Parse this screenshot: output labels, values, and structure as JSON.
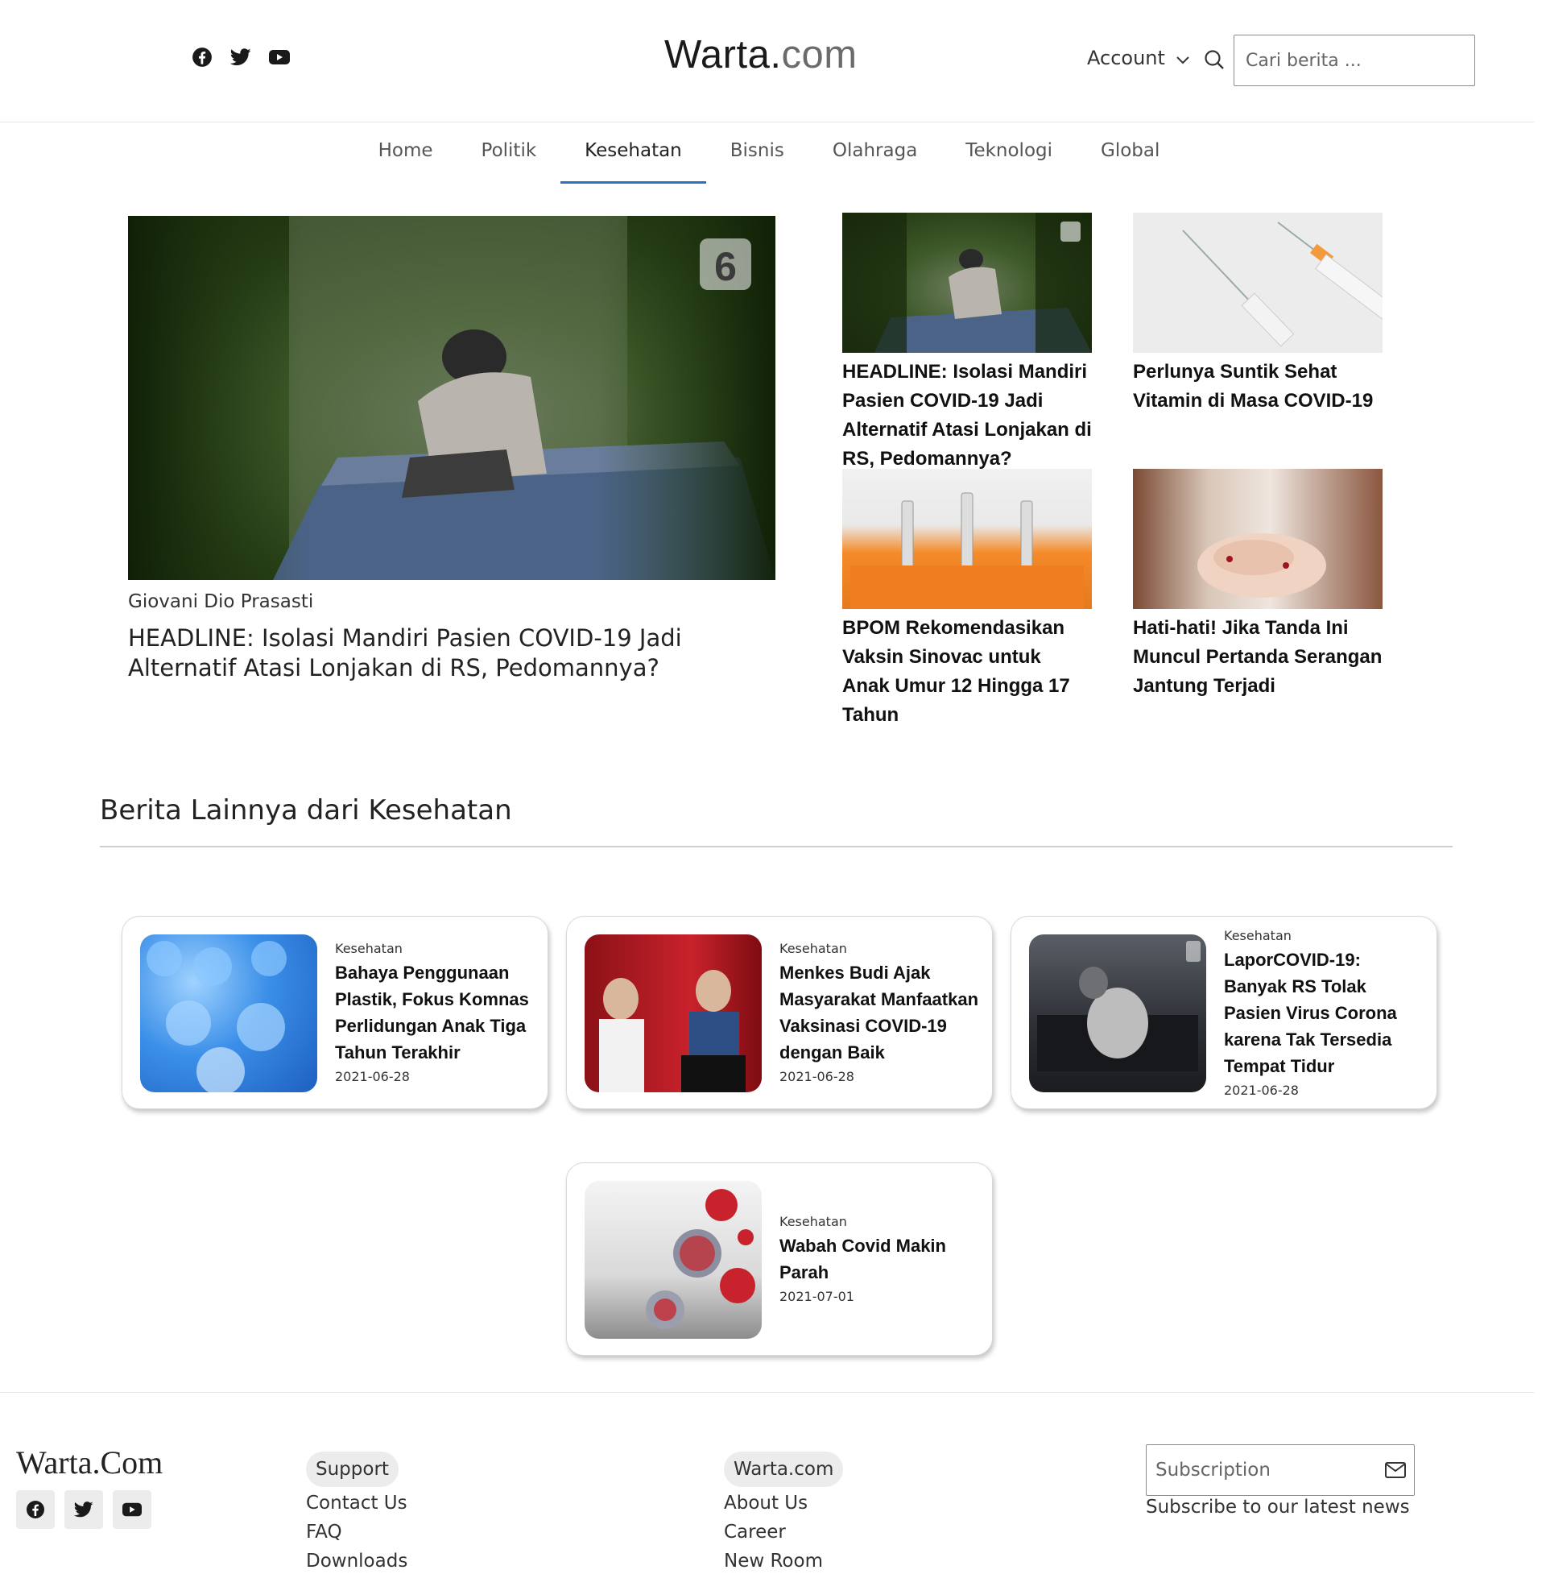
{
  "header": {
    "logo_main": "Warta.",
    "logo_domain": "com",
    "account_label": "Account",
    "search_placeholder": "Cari berita ..."
  },
  "nav": {
    "items": [
      "Home",
      "Politik",
      "Kesehatan",
      "Bisnis",
      "Olahraga",
      "Teknologi",
      "Global"
    ],
    "active": "Kesehatan"
  },
  "hero": {
    "author": "Giovani Dio Prasasti",
    "title": "HEADLINE: Isolasi Mandiri Pasien COVID-19 Jadi Alternatif Atasi Lonjakan di RS, Pedomannya?",
    "watermark": "6"
  },
  "side_articles": [
    {
      "title": "HEADLINE: Isolasi Mandiri Pasien COVID-19 Jadi Alternatif Atasi Lonjakan di RS, Pedomannya?"
    },
    {
      "title": "Perlunya Suntik Sehat Vitamin di Masa COVID-19"
    },
    {
      "title": "BPOM Rekomendasikan Vaksin Sinovac untuk Anak Umur 12 Hingga 17 Tahun"
    },
    {
      "title": "Hati-hati! Jika Tanda Ini Muncul Pertanda Serangan Jantung Terjadi"
    }
  ],
  "section": {
    "title": "Berita Lainnya dari Kesehatan"
  },
  "cards": [
    {
      "category": "Kesehatan",
      "title": "Bahaya Penggunaan Plastik, Fokus Komnas Perlidungan Anak Tiga Tahun Terakhir",
      "date": "2021-06-28"
    },
    {
      "category": "Kesehatan",
      "title": "Menkes Budi Ajak Masyarakat Manfaatkan Vaksinasi COVID-19 dengan Baik",
      "date": "2021-06-28"
    },
    {
      "category": "Kesehatan",
      "title": "LaporCOVID-19: Banyak RS Tolak Pasien Virus Corona karena Tak Tersedia Tempat Tidur",
      "date": "2021-06-28"
    },
    {
      "category": "Kesehatan",
      "title": "Wabah Covid Makin Parah",
      "date": "2021-07-01"
    }
  ],
  "footer": {
    "logo": "Warta.Com",
    "support": {
      "heading": "Support",
      "links": [
        "Contact Us",
        "FAQ",
        "Downloads"
      ]
    },
    "company": {
      "heading": "Warta.com",
      "links": [
        "About Us",
        "Career",
        "New Room"
      ]
    },
    "subscription_placeholder": "Subscription",
    "subscription_note": "Subscribe to our latest news"
  }
}
